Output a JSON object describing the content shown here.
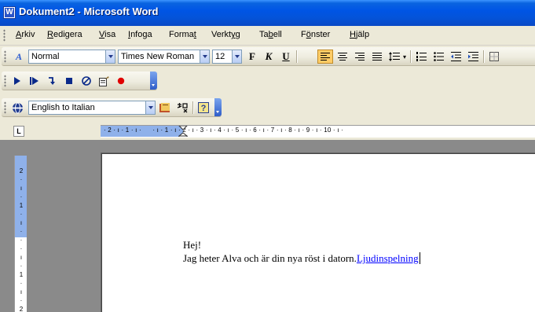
{
  "window": {
    "title": "Dokument2 - Microsoft Word"
  },
  "menu": [
    {
      "label": "Arkiv",
      "key_index": 0
    },
    {
      "label": "Redigera",
      "key_index": 0
    },
    {
      "label": "Visa",
      "key_index": 0
    },
    {
      "label": "Infoga",
      "key_index": 0
    },
    {
      "label": "Format",
      "key_index": 5
    },
    {
      "label": "Verktyg",
      "key_index": 5
    },
    {
      "label": "Tabell",
      "key_index": 2
    },
    {
      "label": "Fönster",
      "key_index": 1
    },
    {
      "label": "Hjälp",
      "key_index": 0
    }
  ],
  "formatting": {
    "style_value": "Normal",
    "font_value": "Times New Roman",
    "size_value": "12",
    "bold_label": "F",
    "italic_label": "K",
    "underline_label": "U"
  },
  "translation": {
    "language_value": "English to Italian"
  },
  "ruler": {
    "tab_selector": "L",
    "horizontal_text": "· 2 · ı · 1 · ı ·      · ı · 1 · ı · 2 · ı · 3 · ı · 4 · ı · 5 · ı · 6 · ı · 7 · ı · 8 · ı · 9 · ı · 10 · ı ·",
    "vertical_numbers": [
      "2",
      "·",
      "ı",
      "·",
      "1",
      "·",
      "ı",
      "·",
      "·",
      "·",
      "ı",
      "·",
      "1",
      "·",
      "ı",
      "·",
      "2"
    ]
  },
  "document": {
    "line1": "Hej!",
    "line2_text": "Jag heter Alva och är din nya röst i datorn.",
    "line2_link": "Ljudinspelning"
  },
  "colors": {
    "titlebar": "#0055e5",
    "active_button": "#ffcc66",
    "link": "#0000ff",
    "ruler_margin": "#8fb1ea"
  }
}
